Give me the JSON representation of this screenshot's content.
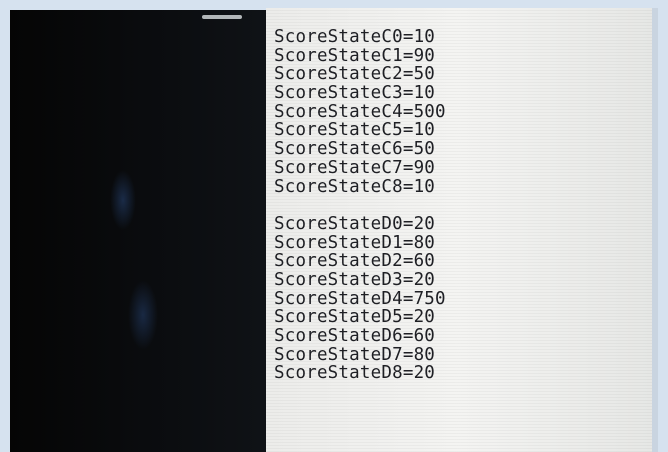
{
  "config_text": {
    "group_c": [
      "ScoreStateC0=10",
      "ScoreStateC1=90",
      "ScoreStateC2=50",
      "ScoreStateC3=10",
      "ScoreStateC4=500",
      "ScoreStateC5=10",
      "ScoreStateC6=50",
      "ScoreStateC7=90",
      "ScoreStateC8=10"
    ],
    "group_d": [
      "ScoreStateD0=20",
      "ScoreStateD1=80",
      "ScoreStateD2=60",
      "ScoreStateD3=20",
      "ScoreStateD4=750",
      "ScoreStateD5=20",
      "ScoreStateD6=60",
      "ScoreStateD7=80",
      "ScoreStateD8=20"
    ]
  }
}
